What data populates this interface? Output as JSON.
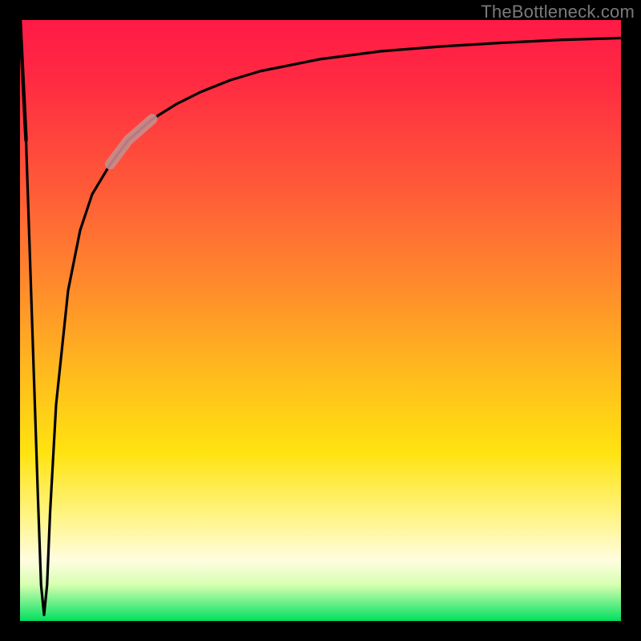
{
  "watermark": "TheBottleneck.com",
  "colors": {
    "frame": "#000000",
    "curve": "#000000",
    "highlight": "#c78e8e",
    "gradient_stops": [
      "#ff1a46",
      "#ff2a42",
      "#ff5a38",
      "#ff8a2c",
      "#ffb81e",
      "#ffe310",
      "#fff58a",
      "#fffde0",
      "#d6ffb0",
      "#00e060"
    ]
  },
  "chart_data": {
    "type": "line",
    "title": "",
    "xlabel": "",
    "ylabel": "",
    "xlim": [
      0,
      100
    ],
    "ylim": [
      0,
      100
    ],
    "notes": "Bottleneck-style curve: a narrow downward spike near x≈4 reaching the minimum (≈0), then a steep rise that asymptotically approaches ≈97. A short highlighted segment sits on the rising limb around x≈15–22. Background gradient runs red (high y) → yellow → green (low y).",
    "series": [
      {
        "name": "bottleneck-curve",
        "x": [
          0,
          1,
          2,
          3,
          3.5,
          4,
          4.5,
          5,
          6,
          8,
          10,
          12,
          15,
          18,
          22,
          26,
          30,
          35,
          40,
          50,
          60,
          70,
          80,
          90,
          100
        ],
        "y": [
          100,
          80,
          50,
          20,
          6,
          1,
          6,
          18,
          36,
          55,
          65,
          71,
          76,
          80,
          83.5,
          86,
          88,
          90,
          91.5,
          93.5,
          94.8,
          95.6,
          96.2,
          96.7,
          97
        ]
      }
    ],
    "highlight_segment": {
      "name": "curve-highlight",
      "x_range": [
        15,
        22
      ],
      "approx_y_range": [
        76,
        83.5
      ]
    }
  }
}
